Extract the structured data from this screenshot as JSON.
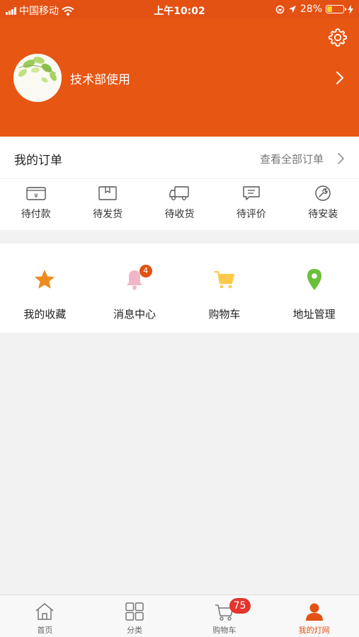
{
  "status_bar": {
    "carrier": "中国移动",
    "time": "上午10:02",
    "battery": "28%",
    "battery_level": 0.28
  },
  "profile": {
    "username": "技术部使用"
  },
  "orders": {
    "title": "我的订单",
    "view_all": "查看全部订单",
    "items": [
      {
        "label": "待付款",
        "icon": "wallet-yen-icon"
      },
      {
        "label": "待发货",
        "icon": "box-icon"
      },
      {
        "label": "待收货",
        "icon": "delivery-truck-icon"
      },
      {
        "label": "待评价",
        "icon": "comment-icon"
      },
      {
        "label": "待安装",
        "icon": "wrench-icon"
      }
    ]
  },
  "services": [
    {
      "label": "我的收藏",
      "icon": "star-icon",
      "color": "#f08a1c"
    },
    {
      "label": "消息中心",
      "icon": "bell-icon",
      "color": "#f0b6c8",
      "badge": "4"
    },
    {
      "label": "购物车",
      "icon": "cart-icon",
      "color": "#fdc94a"
    },
    {
      "label": "地址管理",
      "icon": "location-pin-icon",
      "color": "#6cbf3a"
    }
  ],
  "tabbar": {
    "tabs": [
      {
        "label": "首页",
        "icon": "home-icon"
      },
      {
        "label": "分类",
        "icon": "grid-icon"
      },
      {
        "label": "购物车",
        "icon": "cart-icon",
        "badge": "75"
      },
      {
        "label": "我的灯网",
        "icon": "person-icon",
        "active": true
      }
    ]
  },
  "colors": {
    "brand": "#e85613",
    "status_bar": "#e35113",
    "badge": "#e4342c"
  }
}
